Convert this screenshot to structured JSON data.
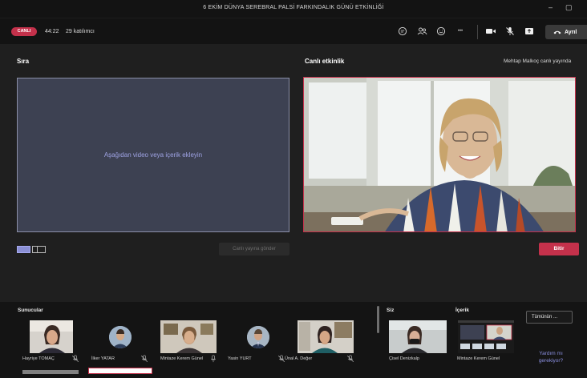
{
  "window": {
    "title": "6 EKİM DÜNYA SEREBRAL PALSİ FARKINDALIK GÜNÜ ETKİNLİĞİ",
    "minimize_glyph": "–",
    "maximize_glyph": "▢"
  },
  "toolbar": {
    "live_badge": "CANLI",
    "elapsed": "44:22",
    "attendees": "29 katılımcı",
    "leave_label": "Ayrıl",
    "icons": [
      "chat-icon",
      "people-icon",
      "reactions-icon",
      "more-icon",
      "camera-icon",
      "mic-off-icon",
      "share-icon",
      "phone-icon"
    ],
    "more_glyph": "•••"
  },
  "queue": {
    "title": "Sıra",
    "hint": "Aşağıdan video veya içerik ekleyin",
    "send_label": "Canlı yayına gönder"
  },
  "live": {
    "title": "Canlı etkinlik",
    "status": "Mehtap Malkoç canlı yayında",
    "end_label": "Bitir"
  },
  "bottom": {
    "presenters_title": "Sunucular",
    "you_title": "Siz",
    "content_title": "İçerik",
    "see_all_label": "Tümünün ...",
    "help_label": "Yardım mı gerekiyor?",
    "presenters": [
      {
        "name": "Hayriye TOMAÇ",
        "type": "video"
      },
      {
        "name": "İlker YATAR",
        "type": "avatar"
      },
      {
        "name": "Mintaze Kerem Günel",
        "type": "video"
      },
      {
        "name": "Yasin YURT",
        "type": "avatar"
      },
      {
        "name": "Ünal A. Değer",
        "type": "video"
      }
    ],
    "you": {
      "name": "Çisel Denizkalp"
    },
    "content": {
      "name": "Mintaze Kerem Günel"
    }
  },
  "colors": {
    "accent": "#6264a7",
    "live_red": "#c4314b",
    "queue_bg": "#3d4152"
  }
}
